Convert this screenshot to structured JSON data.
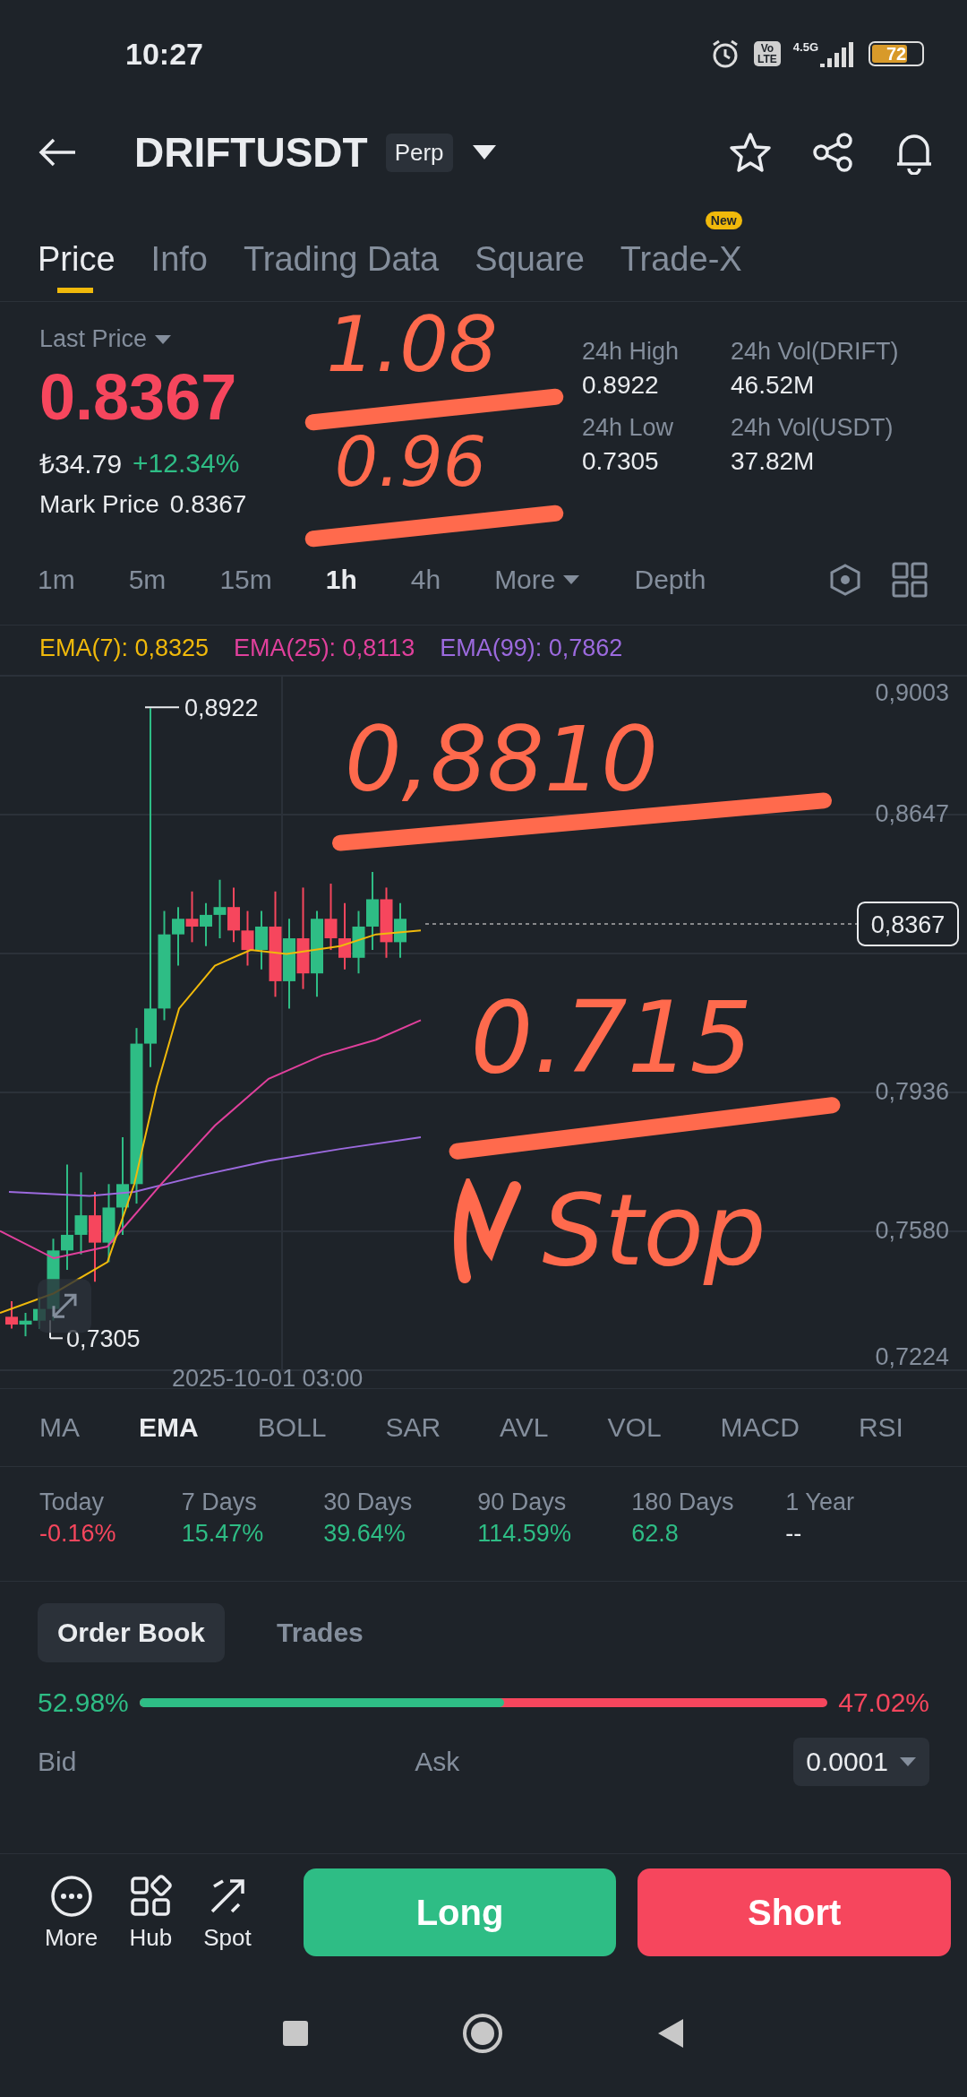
{
  "status_bar": {
    "time": "10:27",
    "volte": [
      "Vo",
      "LTE"
    ],
    "network": "4.5G",
    "battery": "72"
  },
  "header": {
    "symbol": "DRIFTUSDT",
    "badge": "Perp"
  },
  "tabs": [
    {
      "label": "Price",
      "selected": true
    },
    {
      "label": "Info",
      "selected": false
    },
    {
      "label": "Trading Data",
      "selected": false
    },
    {
      "label": "Square",
      "selected": false
    },
    {
      "label": "Trade-X",
      "selected": false,
      "badge": "New"
    }
  ],
  "ticker": {
    "label": "Last Price",
    "price": "0.8367",
    "fiat": "₺34.79",
    "change": "+12.34%",
    "mark_label": "Mark Price",
    "mark_price": "0.8367",
    "stats": [
      {
        "label": "24h High",
        "value": "0.8922"
      },
      {
        "label": "24h Vol(DRIFT)",
        "value": "46.52M"
      },
      {
        "label": "24h Low",
        "value": "0.7305"
      },
      {
        "label": "24h Vol(USDT)",
        "value": "37.82M"
      }
    ]
  },
  "intervals": [
    {
      "label": "1m",
      "selected": false
    },
    {
      "label": "5m",
      "selected": false
    },
    {
      "label": "15m",
      "selected": false
    },
    {
      "label": "1h",
      "selected": true
    },
    {
      "label": "4h",
      "selected": false
    },
    {
      "label": "More",
      "selected": false,
      "kind": "menu"
    },
    {
      "label": "Depth",
      "selected": false
    }
  ],
  "ema_legend": [
    {
      "label": "EMA(7): 0,8325",
      "color": "#f0b90b"
    },
    {
      "label": "EMA(25): 0,8113",
      "color": "#e0409c"
    },
    {
      "label": "EMA(99): 0,7862",
      "color": "#9c6ade"
    }
  ],
  "chart": {
    "y_labels": [
      "0,9003",
      "0,8647",
      "0,7936",
      "0,7580",
      "0,7224"
    ],
    "high_marker": "0,8922",
    "low_marker": "0,7305",
    "current_price": "0,8367",
    "x_label": "2025-10-01 03:00"
  },
  "indicators": [
    {
      "label": "MA",
      "selected": false
    },
    {
      "label": "EMA",
      "selected": true
    },
    {
      "label": "BOLL",
      "selected": false
    },
    {
      "label": "SAR",
      "selected": false
    },
    {
      "label": "AVL",
      "selected": false
    },
    {
      "label": "VOL",
      "selected": false
    },
    {
      "label": "MACD",
      "selected": false
    },
    {
      "label": "RSI",
      "selected": false
    }
  ],
  "performance": [
    {
      "label": "Today",
      "value": "-0.16%",
      "kind": "down"
    },
    {
      "label": "7 Days",
      "value": "15.47%",
      "kind": "up"
    },
    {
      "label": "30 Days",
      "value": "39.64%",
      "kind": "up"
    },
    {
      "label": "90 Days",
      "value": "114.59%",
      "kind": "up"
    },
    {
      "label": "180 Days",
      "value": "62.8",
      "kind": "up"
    },
    {
      "label": "1 Year",
      "value": "--",
      "kind": "neutral"
    }
  ],
  "book_tabs": [
    {
      "label": "Order Book",
      "selected": true
    },
    {
      "label": "Trades",
      "selected": false
    }
  ],
  "ratio": {
    "bid": "52.98%",
    "ask": "47.02%",
    "level": 0.5298
  },
  "book": {
    "bid_label": "Bid",
    "ask_label": "Ask",
    "precision": "0.0001"
  },
  "actions": [
    {
      "label": "More",
      "kind": "more"
    },
    {
      "label": "Hub",
      "kind": "hub"
    },
    {
      "label": "Spot",
      "kind": "spot"
    }
  ],
  "trade_buttons": [
    {
      "label": "Long",
      "kind": "long"
    },
    {
      "label": "Short",
      "kind": "short"
    }
  ],
  "annotations": [
    "1.08",
    "0.96",
    "0,8810",
    "0.715",
    "Stop"
  ]
}
